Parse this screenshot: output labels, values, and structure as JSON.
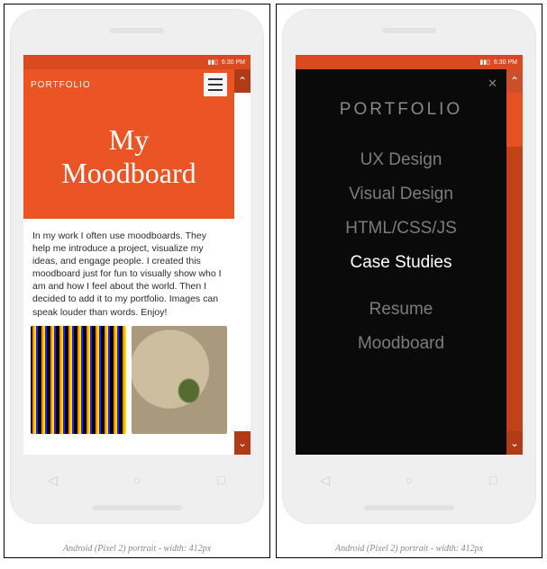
{
  "device_caption": "Android (Pixel 2) portrait - width: 412px",
  "statusbar": {
    "time": "6:30 PM"
  },
  "left": {
    "brand": "PORTFOLIO",
    "hero_title_line1": "My",
    "hero_title_line2": "Moodboard",
    "paragraph": "In my work I often use moodboards. They help me introduce a project, visualize my ideas, and engage people. I created this moodboard just for fun to visually show who I am and how I feel about the world. Then I decided to add it to my portfolio. Images can speak louder than words. Enjoy!"
  },
  "right": {
    "brand": "PORTFOLIO",
    "close_glyph": "✕",
    "items": [
      {
        "label": "UX Design",
        "active": false
      },
      {
        "label": "Visual Design",
        "active": false
      },
      {
        "label": "HTML/CSS/JS",
        "active": false
      },
      {
        "label": "Case Studies",
        "active": true
      }
    ],
    "secondary": [
      {
        "label": "Resume"
      },
      {
        "label": "Moodboard"
      }
    ]
  },
  "nav_icons": {
    "back": "◁",
    "home": "○",
    "recent": "□"
  },
  "scroll": {
    "up": "⌃",
    "down": "⌄"
  }
}
